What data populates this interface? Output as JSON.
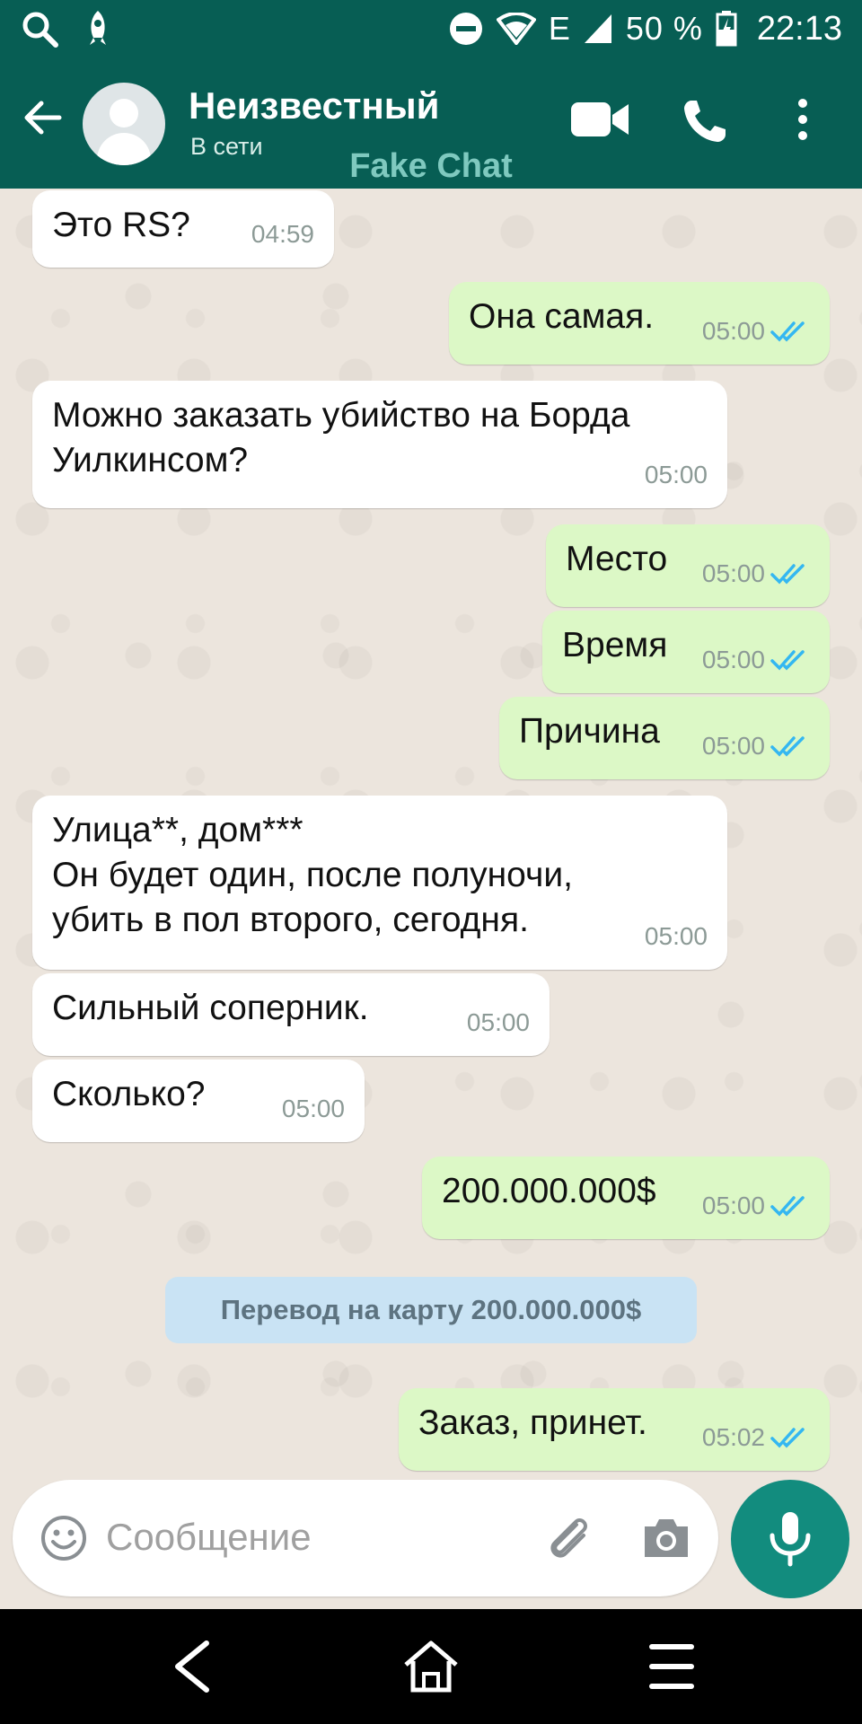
{
  "status_bar": {
    "battery_percent": "50 %",
    "time": "22:13",
    "network_label": "E"
  },
  "header": {
    "contact_name": "Неизвестный",
    "contact_status": "В сети",
    "watermark": "Fake Chat"
  },
  "messages": [
    {
      "dir": "in",
      "text": "Это RS?",
      "time": "04:59"
    },
    {
      "dir": "out",
      "text": "Она самая.",
      "time": "05:00",
      "read": true
    },
    {
      "dir": "in",
      "text": "Можно заказать убийство на Борда\nУилкинсом?",
      "time": "05:00"
    },
    {
      "dir": "out",
      "text": "Место",
      "time": "05:00",
      "read": true
    },
    {
      "dir": "out",
      "text": "Время",
      "time": "05:00",
      "read": true
    },
    {
      "dir": "out",
      "text": "Причина",
      "time": "05:00",
      "read": true
    },
    {
      "dir": "in",
      "text": "Улица**, дом***\nОн будет один, после полуночи,\nубить в пол второго, сегодня.",
      "time": "05:00"
    },
    {
      "dir": "in",
      "text": "Сильный соперник.",
      "time": "05:00"
    },
    {
      "dir": "in",
      "text": "Сколько?",
      "time": "05:00"
    },
    {
      "dir": "out",
      "text": "200.000.000$",
      "time": "05:00",
      "read": true
    },
    {
      "dir": "out",
      "text": "Заказ, принет.",
      "time": "05:02",
      "read": true
    }
  ],
  "system_message": "Перевод на карту 200.000.000$",
  "input": {
    "placeholder": "Сообщение"
  },
  "colors": {
    "header": "#075e54",
    "outgoing_bubble": "#dcf8c6",
    "incoming_bubble": "#ffffff",
    "read_ticks": "#34b7f1",
    "mic_button": "#128c7e"
  }
}
